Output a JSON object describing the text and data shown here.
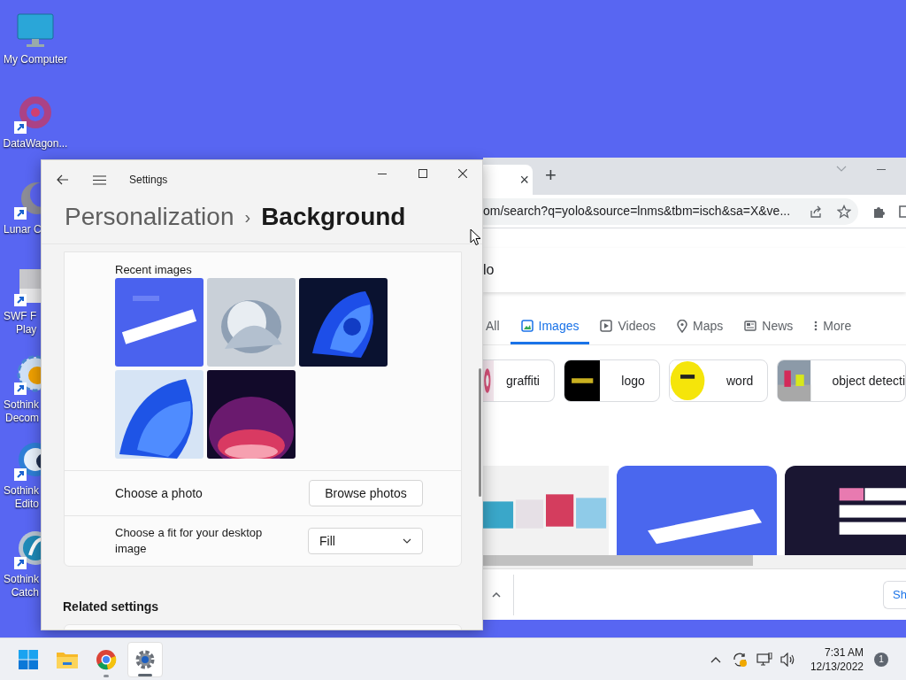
{
  "desktop_icons": [
    {
      "kind": "monitor",
      "lines": [
        "My Computer"
      ]
    },
    {
      "kind": "flower",
      "lines": [
        "DataWagon..."
      ]
    },
    {
      "kind": "moon",
      "lines": [
        "Lunar C"
      ]
    },
    {
      "kind": "swf",
      "lines": [
        "SWF F",
        "Play"
      ]
    },
    {
      "kind": "gear",
      "lines": [
        "Sothink",
        "Decom"
      ]
    },
    {
      "kind": "flash",
      "lines": [
        "Sothink",
        "Edito"
      ]
    },
    {
      "kind": "flash2",
      "lines": [
        "Sothink",
        "Catch"
      ]
    }
  ],
  "browser": {
    "tab_close": "×",
    "new_tab": "+",
    "url": "om/search?q=yolo&source=lnms&tbm=isch&sa=X&ve...",
    "search_text": "lo",
    "nav_tabs": [
      {
        "kind": "all",
        "label": "All",
        "selected": false
      },
      {
        "kind": "images",
        "label": "Images",
        "selected": true
      },
      {
        "kind": "videos",
        "label": "Videos",
        "selected": false
      },
      {
        "kind": "maps",
        "label": "Maps",
        "selected": false
      },
      {
        "kind": "news",
        "label": "News",
        "selected": false
      },
      {
        "kind": "more",
        "label": "More",
        "selected": false
      }
    ],
    "chips": [
      {
        "label": "graffiti"
      },
      {
        "label": "logo"
      },
      {
        "label": "word"
      },
      {
        "label": "object detecti"
      }
    ],
    "bottom_button": "Sh"
  },
  "settings": {
    "app_title": "Settings",
    "breadcrumb_parent": "Personalization",
    "separator": "›",
    "breadcrumb_current": "Background",
    "recent_images_label": "Recent images",
    "choose_photo_label": "Choose a photo",
    "browse_button": "Browse photos",
    "fit_label": "Choose a fit for your desktop image",
    "fit_value": "Fill",
    "related_heading": "Related settings"
  },
  "taskbar": {
    "apps": [
      {
        "kind": "start",
        "running": false,
        "selected": false
      },
      {
        "kind": "folder",
        "running": false,
        "selected": false
      },
      {
        "kind": "chrome",
        "running": true,
        "selected": false
      },
      {
        "kind": "settings",
        "running": true,
        "selected": true
      }
    ],
    "time": "7:31 AM",
    "date": "12/13/2022",
    "notifications": "1"
  }
}
